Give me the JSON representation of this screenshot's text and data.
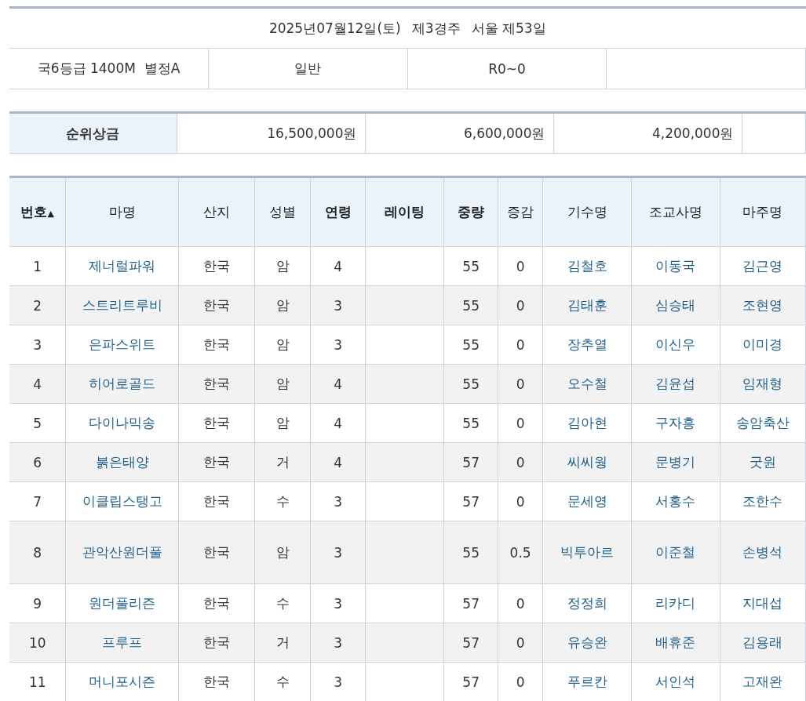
{
  "race_info": {
    "date": "2025년07월12일(토)",
    "race": "제3경주",
    "venue_day": "서울 제53일",
    "conditions": [
      "국6등급 1400M  별정A",
      "일반",
      "R0~0"
    ]
  },
  "prize": {
    "label": "순위상금",
    "amounts": [
      "16,500,000원",
      "6,600,000원",
      "4,200,000원"
    ]
  },
  "entries": {
    "columns": [
      {
        "label": "번호",
        "sortable": true,
        "sort_mark": "▲",
        "kind": "text"
      },
      {
        "label": "마명",
        "sortable": false,
        "kind": "link"
      },
      {
        "label": "산지",
        "sortable": false,
        "kind": "text"
      },
      {
        "label": "성별",
        "sortable": false,
        "kind": "text"
      },
      {
        "label": "연령",
        "sortable": true,
        "kind": "text"
      },
      {
        "label": "레이팅",
        "sortable": true
      },
      {
        "label": "중량",
        "sortable": true,
        "kind": "text"
      },
      {
        "label": "증감",
        "sortable": false,
        "kind": "text"
      },
      {
        "label": "기수명",
        "sortable": false,
        "kind": "link"
      },
      {
        "label": "조교사명",
        "sortable": false,
        "kind": "link"
      },
      {
        "label": "마주명",
        "sortable": false,
        "kind": "link"
      }
    ],
    "rows": [
      [
        "1",
        "제너럴파워",
        "한국",
        "암",
        "4",
        null,
        "55",
        "0",
        "김철호",
        "이동국",
        "김근영"
      ],
      [
        "2",
        "스트리트루비",
        "한국",
        "암",
        "3",
        null,
        "55",
        "0",
        "김태훈",
        "심승태",
        "조현영"
      ],
      [
        "3",
        "은파스위트",
        "한국",
        "암",
        "3",
        null,
        "55",
        "0",
        "장추열",
        "이신우",
        "이미경"
      ],
      [
        "4",
        "히어로골드",
        "한국",
        "암",
        "4",
        null,
        "55",
        "0",
        "오수철",
        "김윤섭",
        "임재형"
      ],
      [
        "5",
        "다이나믹송",
        "한국",
        "암",
        "4",
        null,
        "55",
        "0",
        "김아현",
        "구자흥",
        "송암축산"
      ],
      [
        "6",
        "붉은태양",
        "한국",
        "거",
        "4",
        null,
        "57",
        "0",
        "씨씨웡",
        "문병기",
        "굿원"
      ],
      [
        "7",
        "이클립스탱고",
        "한국",
        "수",
        "3",
        null,
        "57",
        "0",
        "문세영",
        "서홍수",
        "조한수"
      ],
      [
        "8",
        "관악산원더풀",
        "한국",
        "암",
        "3",
        null,
        "55",
        "0.5",
        "빅투아르",
        "이준철",
        "손병석"
      ],
      [
        "9",
        "원더풀리즌",
        "한국",
        "수",
        "3",
        null,
        "57",
        "0",
        "정정희",
        "리카디",
        "지대섭"
      ],
      [
        "10",
        "프루프",
        "한국",
        "거",
        "3",
        null,
        "57",
        "0",
        "유승완",
        "배휴준",
        "김용래"
      ],
      [
        "11",
        "머니포시즌",
        "한국",
        "수",
        "3",
        null,
        "57",
        "0",
        "푸르칸",
        "서인석",
        "고재완"
      ]
    ]
  }
}
